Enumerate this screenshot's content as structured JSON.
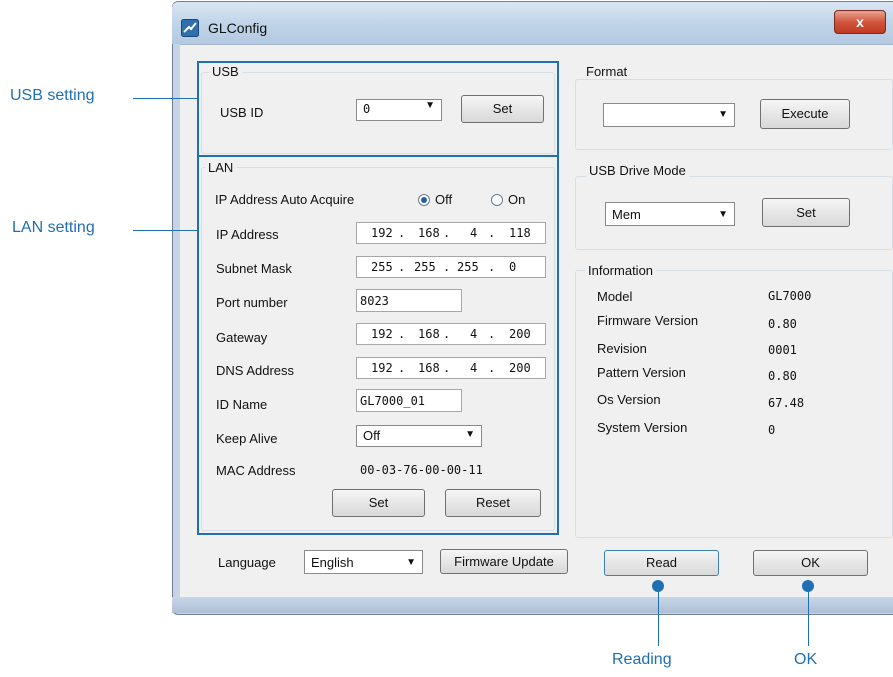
{
  "window": {
    "title": "GLConfig",
    "close_label": "x"
  },
  "usb": {
    "group_label": "USB",
    "id_label": "USB ID",
    "id_value": "0",
    "set_label": "Set"
  },
  "lan": {
    "group_label": "LAN",
    "auto_acquire_label": "IP Address Auto Acquire",
    "off_label": "Off",
    "on_label": "On",
    "auto_acquire_selected": "Off",
    "ip_label": "IP Address",
    "ip": [
      "192",
      "168",
      "4",
      "118"
    ],
    "subnet_label": "Subnet Mask",
    "subnet": [
      "255",
      "255",
      "255",
      "0"
    ],
    "port_label": "Port number",
    "port": "8023",
    "gateway_label": "Gateway",
    "gateway": [
      "192",
      "168",
      "4",
      "200"
    ],
    "dns_label": "DNS Address",
    "dns": [
      "192",
      "168",
      "4",
      "200"
    ],
    "idname_label": "ID Name",
    "idname": "GL7000_01",
    "keepalive_label": "Keep Alive",
    "keepalive": "Off",
    "mac_label": "MAC Address",
    "mac": "00-03-76-00-00-11",
    "set_label": "Set",
    "reset_label": "Reset"
  },
  "format": {
    "group_label": "Format",
    "value": "",
    "execute_label": "Execute"
  },
  "usb_drive": {
    "group_label": "USB Drive Mode",
    "value": "Mem",
    "set_label": "Set"
  },
  "info": {
    "group_label": "Information",
    "rows": [
      {
        "label": "Model",
        "value": "GL7000"
      },
      {
        "label": "Firmware Version",
        "value": "0.80"
      },
      {
        "label": "Revision",
        "value": "0001"
      },
      {
        "label": "Pattern Version",
        "value": "0.80"
      },
      {
        "label": "Os Version",
        "value": "67.48"
      },
      {
        "label": "System Version",
        "value": "0"
      }
    ]
  },
  "footer": {
    "language_label": "Language",
    "language_value": "English",
    "firmware_update_label": "Firmware Update",
    "read_label": "Read",
    "ok_label": "OK"
  },
  "callouts": {
    "usb_setting": "USB setting",
    "lan_setting": "LAN setting",
    "reading": "Reading",
    "ok": "OK"
  },
  "colors": {
    "accent": "#1f6fb2",
    "dialog_bg": "#f0f0f0"
  }
}
